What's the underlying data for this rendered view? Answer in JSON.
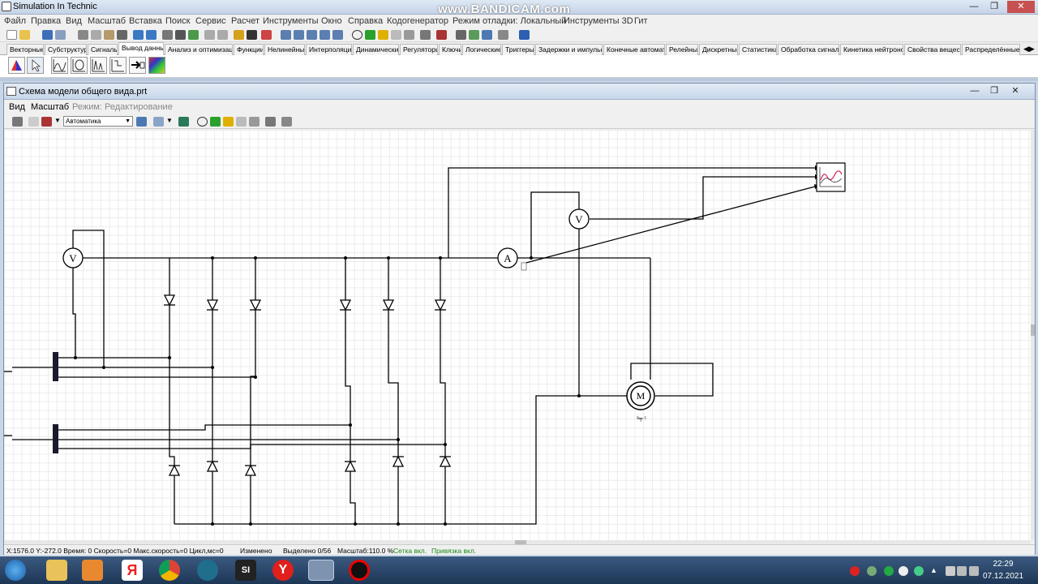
{
  "app": {
    "title": "Simulation In Technic",
    "watermark": "www.BANDICAM.com"
  },
  "menu": [
    "Файл",
    "Правка",
    "Вид",
    "Масштаб",
    "Вставка",
    "Поиск",
    "Сервис",
    "Расчет",
    "Инструменты",
    "Окно",
    "Справка",
    "Кодогенератор",
    "Режим отладки: Локальный",
    "Инструменты 3D",
    "Гит"
  ],
  "tabs": [
    "Векторные",
    "Субструктуры",
    "Сигналы",
    "Вывод данных",
    "Анализ и оптимизация",
    "Функции",
    "Нелинейные",
    "Интерполяция",
    "Динамические",
    "Регуляторы",
    "Ключи",
    "Логические",
    "Триггеры",
    "Задержки и импульсы",
    "Конечные автоматы",
    "Релейные",
    "Дискретные",
    "Статистика",
    "Обработка сигналов",
    "Кинетика нейтронов",
    "Свойства веществ",
    "Распределённые СГ"
  ],
  "active_tab": "Вывод данных",
  "child": {
    "title": "Схема модели общего вида.prt",
    "menu": [
      "Вид",
      "Масштаб"
    ],
    "mode_label": "Режим: Редактирование",
    "solver_select": "Автоматика"
  },
  "schematic": {
    "voltmeter_label": "V",
    "ammeter_label": "A",
    "motor_label": "M",
    "motor_pins": "ᵃ╤ ᶜ"
  },
  "status": {
    "coords": "X:1576.0  Y:-272.0 Время: 0 Скорость=0 Макс.скорость=0 Цикл,мс=0",
    "changed": "Изменено",
    "selected": "Выделено 0/56",
    "scale": "Масштаб:110.0 %",
    "grid": "Сетка вкл.",
    "snap": "Привязка вкл."
  },
  "clock": {
    "time": "22:29",
    "date": "07.12.2021"
  },
  "colors": {
    "taskbar": "#1d3656",
    "status_green": "#1a8a1a",
    "wire": "#000000"
  }
}
